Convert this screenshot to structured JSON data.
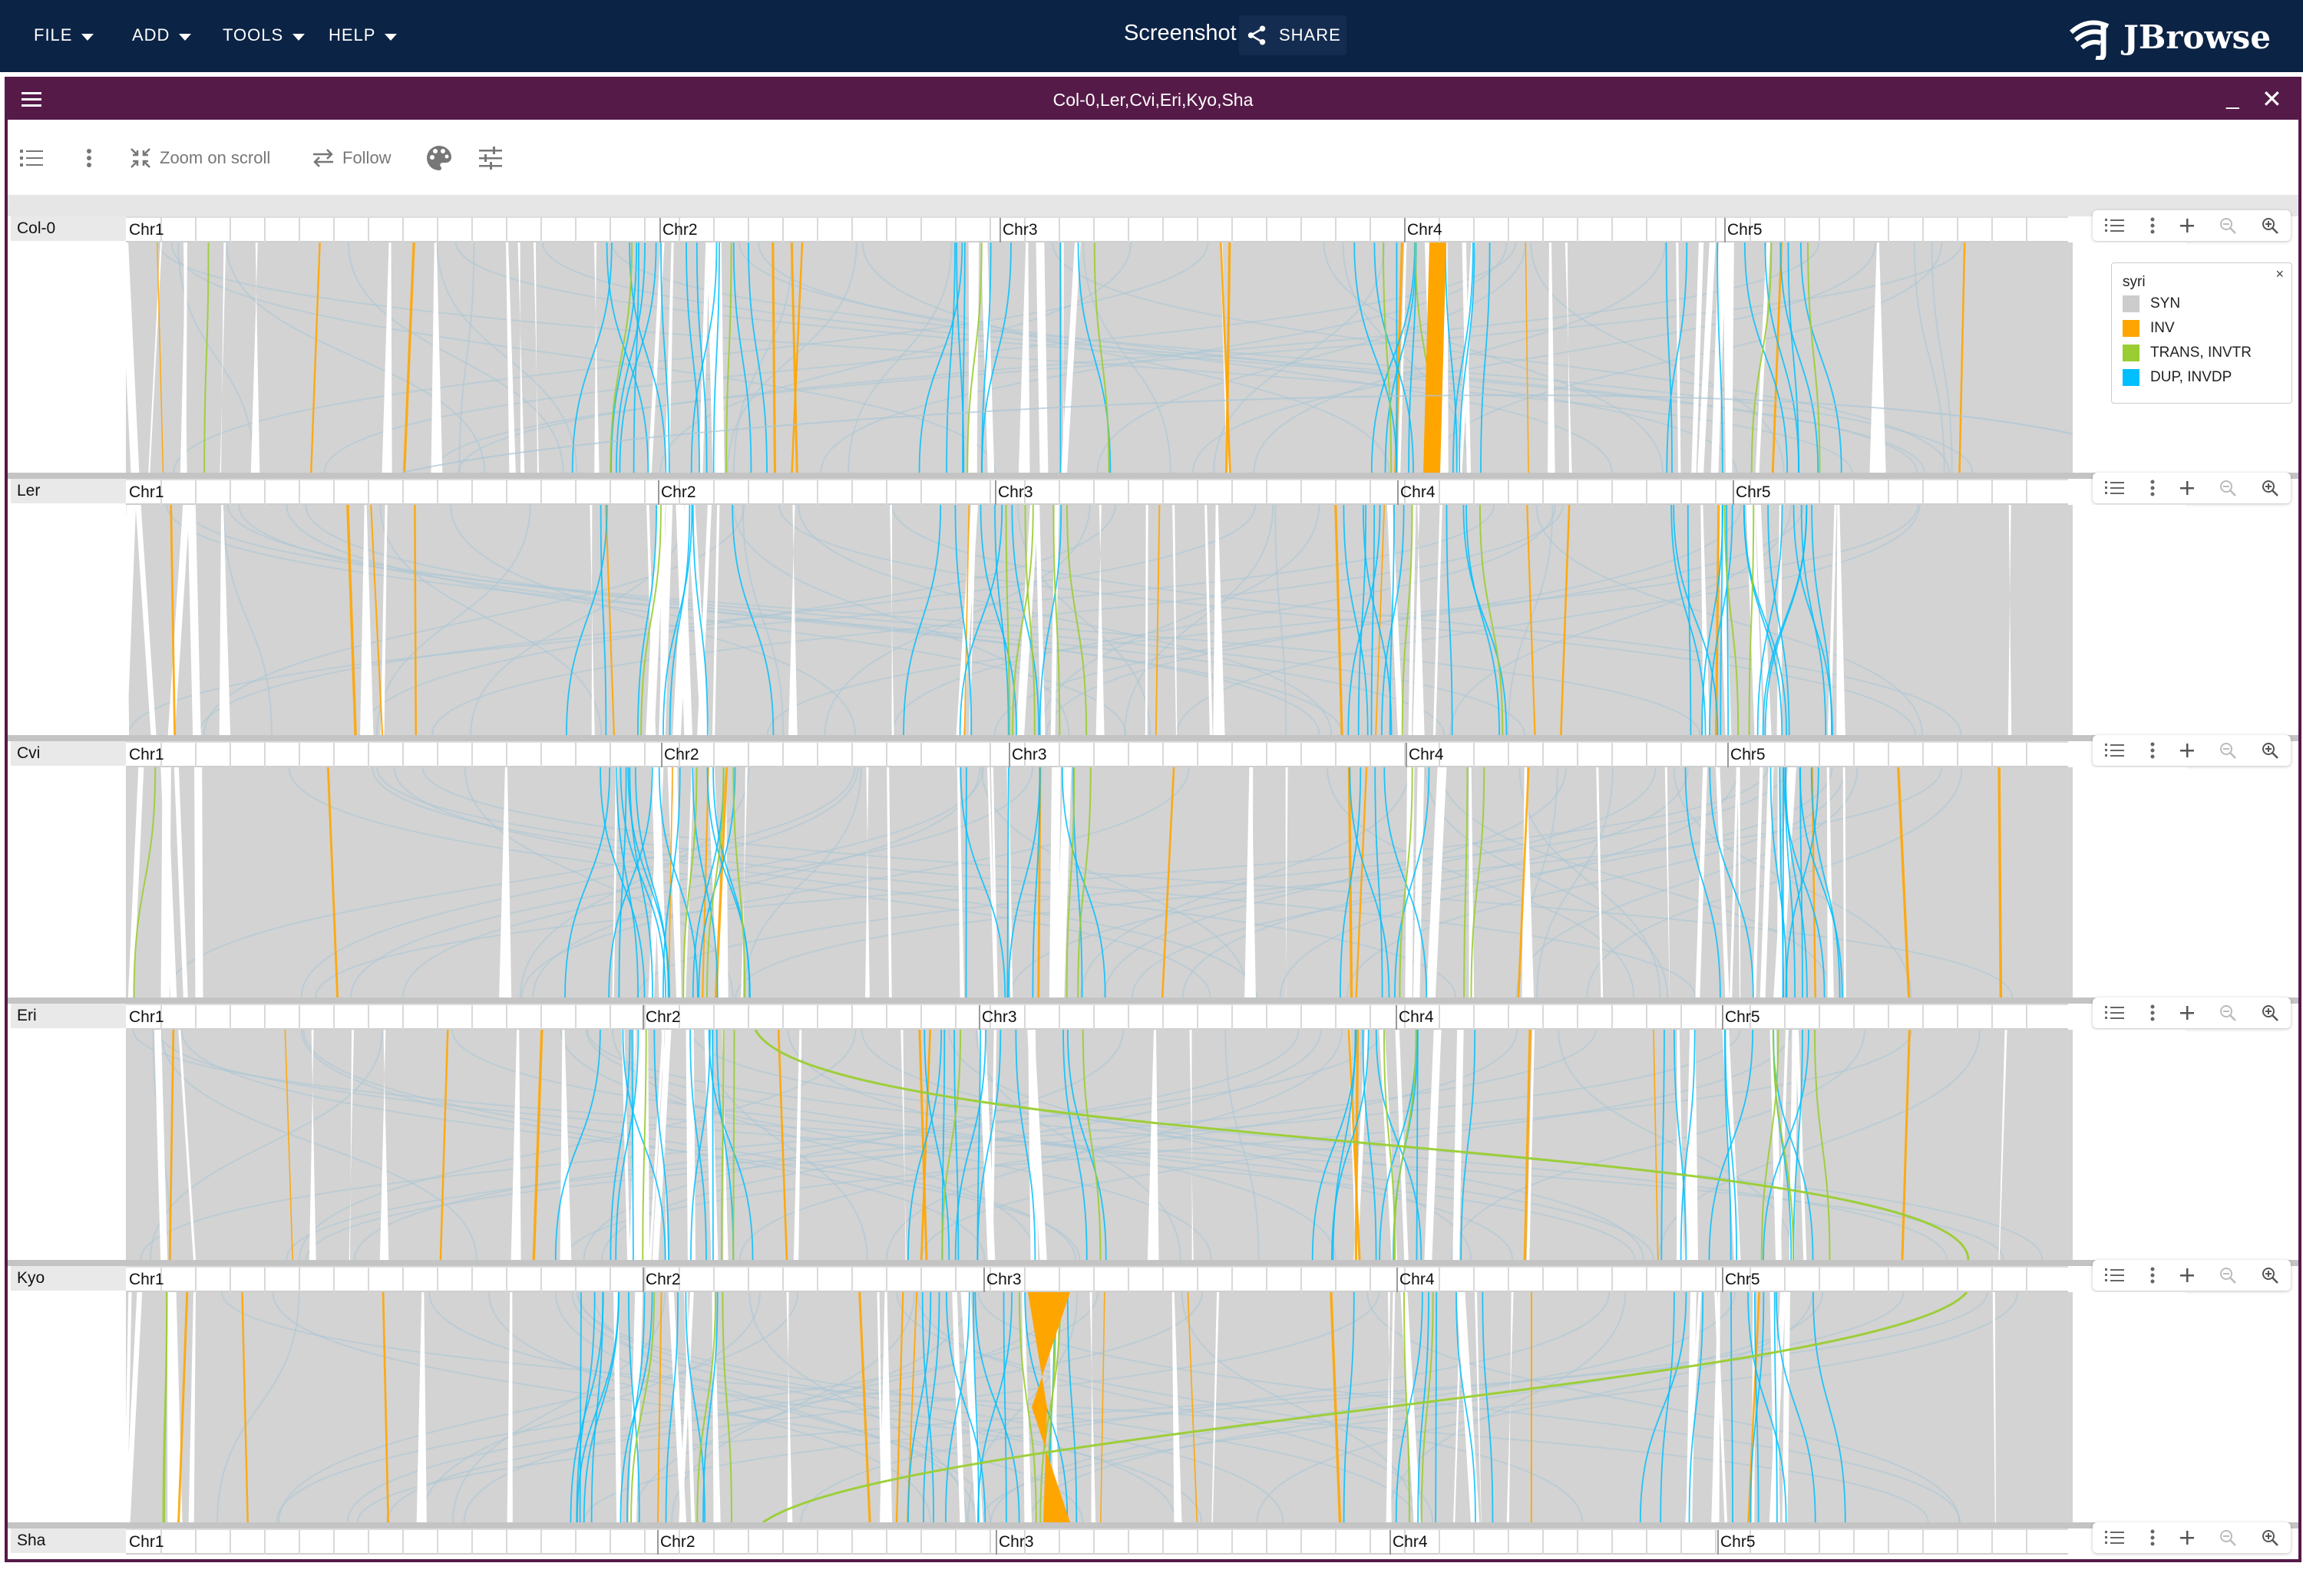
{
  "appbar": {
    "menus": [
      "FILE",
      "ADD",
      "TOOLS",
      "HELP"
    ],
    "session_title": "Screenshot",
    "share_label": "SHARE",
    "logo_text": "JBrowse",
    "background": "#0b2345"
  },
  "view": {
    "title": "Col-0,Ler,Cvi,Eri,Kyo,Sha",
    "frame_color": "#561a48",
    "toolbar": {
      "zoom_on_scroll": "Zoom on scroll",
      "follow": "Follow"
    }
  },
  "assemblies": [
    {
      "name": "Col-0",
      "chromosomes": [
        "Chr1",
        "Chr2",
        "Chr3",
        "Chr4",
        "Chr5"
      ]
    },
    {
      "name": "Ler",
      "chromosomes": [
        "Chr1",
        "Chr2",
        "Chr3",
        "Chr4",
        "Chr5"
      ]
    },
    {
      "name": "Cvi",
      "chromosomes": [
        "Chr1",
        "Chr2",
        "Chr3",
        "Chr4",
        "Chr5"
      ]
    },
    {
      "name": "Eri",
      "chromosomes": [
        "Chr1",
        "Chr2",
        "Chr3",
        "Chr4",
        "Chr5"
      ]
    },
    {
      "name": "Kyo",
      "chromosomes": [
        "Chr1",
        "Chr2",
        "Chr3",
        "Chr4",
        "Chr5"
      ]
    },
    {
      "name": "Sha",
      "chromosomes": [
        "Chr1",
        "Chr2",
        "Chr3",
        "Chr4",
        "Chr5"
      ]
    }
  ],
  "legend": {
    "title": "syri",
    "close": "×",
    "items": [
      {
        "label": "SYN",
        "color": "#cccccc"
      },
      {
        "label": "INV",
        "color": "#ffa500"
      },
      {
        "label": "TRANS, INVTR",
        "color": "#9acd32"
      },
      {
        "label": "DUP, INVDP",
        "color": "#00bfff"
      }
    ]
  },
  "colors": {
    "syn_background": "#d3d3d3",
    "inv": "#ffa500",
    "trans": "#9acd32",
    "dup": "#00bfff",
    "faint_link": "#a9c6d6"
  },
  "icons": [
    "hamburger-menu-icon",
    "minimize-icon",
    "close-icon",
    "track-list-icon",
    "more-vertical-icon",
    "zoom-on-scroll-icon",
    "follow-icon",
    "palette-icon",
    "settings-sliders-icon",
    "share-icon",
    "jbrowse-logo-icon",
    "zoom-in-icon",
    "zoom-out-icon",
    "add-icon"
  ]
}
